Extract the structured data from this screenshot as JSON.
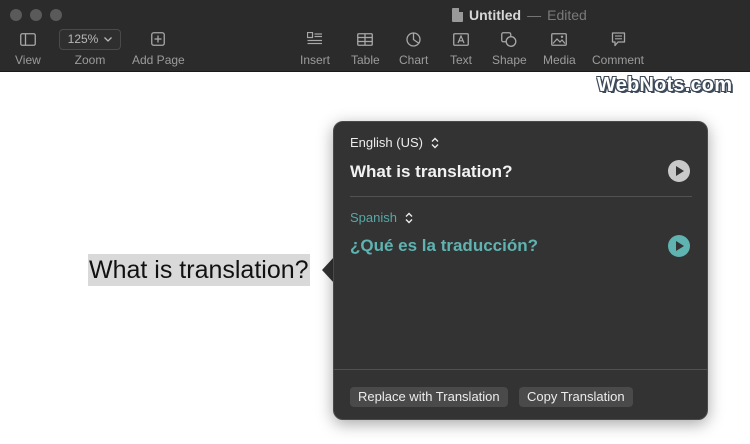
{
  "window": {
    "title": "Untitled",
    "separator": "—",
    "status": "Edited"
  },
  "toolbar": {
    "view_label": "View",
    "zoom_value": "125%",
    "zoom_label": "Zoom",
    "add_page_label": "Add Page",
    "insert_label": "Insert",
    "table_label": "Table",
    "chart_label": "Chart",
    "text_label": "Text",
    "shape_label": "Shape",
    "media_label": "Media",
    "comment_label": "Comment"
  },
  "watermark": "WebNots.com",
  "document": {
    "selected_text": "What is translation?"
  },
  "translation": {
    "source_language": "English (US)",
    "source_text": "What is translation?",
    "target_language": "Spanish",
    "target_text": "¿Qué es la traducción?",
    "replace_button": "Replace with Translation",
    "copy_button": "Copy Translation",
    "accent_color": "#5fb3b1"
  }
}
